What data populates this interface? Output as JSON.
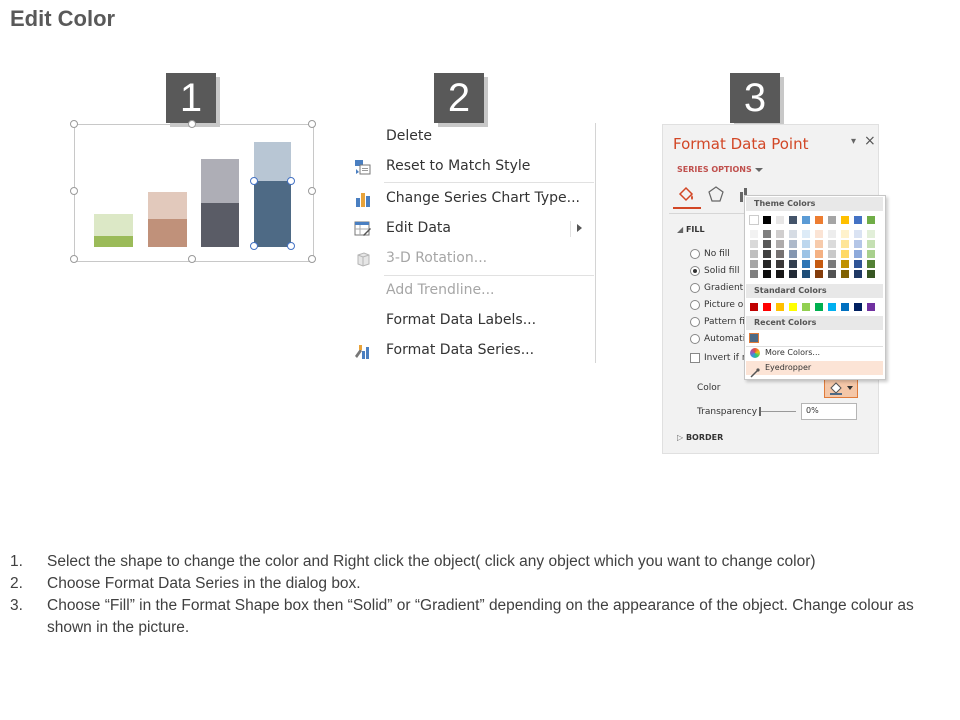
{
  "title": "Edit Color",
  "steps": [
    "1",
    "2",
    "3"
  ],
  "chart_colors": {
    "green_light": "#dce8c6",
    "green_dark": "#9bbb59",
    "brown_light": "#e2c9bc",
    "brown_dark": "#c0917a",
    "gray_light": "#aeaeb6",
    "gray_dark": "#5a5c66",
    "blue_light": "#b8c6d4",
    "blue_dark": "#4e6a85"
  },
  "context_menu": {
    "items": [
      {
        "label": "Delete",
        "icon": "none",
        "disabled": false
      },
      {
        "label": "Reset to Match Style",
        "icon": "reset-style-icon",
        "disabled": false
      },
      {
        "label": "Change Series Chart Type...",
        "icon": "bar-chart-icon",
        "disabled": false
      },
      {
        "label": "Edit Data",
        "icon": "edit-data-icon",
        "disabled": false,
        "submenu": true
      },
      {
        "label": "3-D Rotation...",
        "icon": "cube-icon",
        "disabled": true
      },
      {
        "label": "Add Trendline...",
        "icon": "none",
        "disabled": true
      },
      {
        "label": "Format Data Labels...",
        "icon": "none",
        "disabled": false
      },
      {
        "label": "Format Data Series...",
        "icon": "format-series-icon",
        "disabled": false
      }
    ]
  },
  "format_panel": {
    "title": "Format Data Point",
    "series_options": "SERIES OPTIONS",
    "fill_header": "FILL",
    "fill_options": [
      "No fill",
      "Solid fill",
      "Gradient fi",
      "Picture or",
      "Pattern fill",
      "Automatic"
    ],
    "invert_label": "Invert if ne",
    "color_label": "Color",
    "transparency_label": "Transparency",
    "transparency_value": "0%",
    "border_header": "BORDER",
    "close": "×",
    "pin": "▾"
  },
  "palette": {
    "theme_header": "Theme Colors",
    "standard_header": "Standard Colors",
    "recent_header": "Recent Colors",
    "more_colors": "More Colors...",
    "eyedropper": "Eyedropper",
    "theme_top": [
      "#ffffff",
      "#000000",
      "#e7e6e6",
      "#44546a",
      "#5b9bd5",
      "#ed7d31",
      "#a5a5a5",
      "#ffc000",
      "#4472c4",
      "#70ad47"
    ],
    "theme_shades": [
      [
        "#f2f2f2",
        "#7f7f7f",
        "#d0cece",
        "#d6dce4",
        "#ddebf7",
        "#fbe4d5",
        "#ededed",
        "#fff2cc",
        "#dae3f3",
        "#e2efd9"
      ],
      [
        "#d9d9d9",
        "#595959",
        "#aeabab",
        "#adb9ca",
        "#bdd7ee",
        "#f7cbac",
        "#dbdbdb",
        "#fee599",
        "#b4c6e7",
        "#c5e0b3"
      ],
      [
        "#bfbfbf",
        "#404040",
        "#767171",
        "#8496b0",
        "#9cc3e5",
        "#f4b183",
        "#c9c9c9",
        "#ffd966",
        "#8eaadb",
        "#a8d08d"
      ],
      [
        "#a6a6a6",
        "#262626",
        "#3a3838",
        "#323f4f",
        "#2e75b5",
        "#c55a11",
        "#7b7b7b",
        "#bf9000",
        "#2f5496",
        "#538135"
      ],
      [
        "#7f7f7f",
        "#0d0d0d",
        "#171616",
        "#222a35",
        "#1e4e79",
        "#833c0b",
        "#525252",
        "#7f6000",
        "#1f3864",
        "#375623"
      ]
    ],
    "standard": [
      "#c00000",
      "#ff0000",
      "#ffc000",
      "#ffff00",
      "#92d050",
      "#00b050",
      "#00b0f0",
      "#0070c0",
      "#002060",
      "#7030a0"
    ],
    "recent": [
      "#4e6a85"
    ]
  },
  "instructions": [
    {
      "num": "1.",
      "text": "Select the shape to change the color and Right click the object( click any object which you want to change color)"
    },
    {
      "num": "2.",
      "text": "Choose Format Data Series in the dialog box."
    },
    {
      "num": "3.",
      "text": "Choose “Fill” in the Format Shape box then “Solid” or “Gradient” depending on the appearance of the object. Change colour as shown in the picture."
    }
  ]
}
